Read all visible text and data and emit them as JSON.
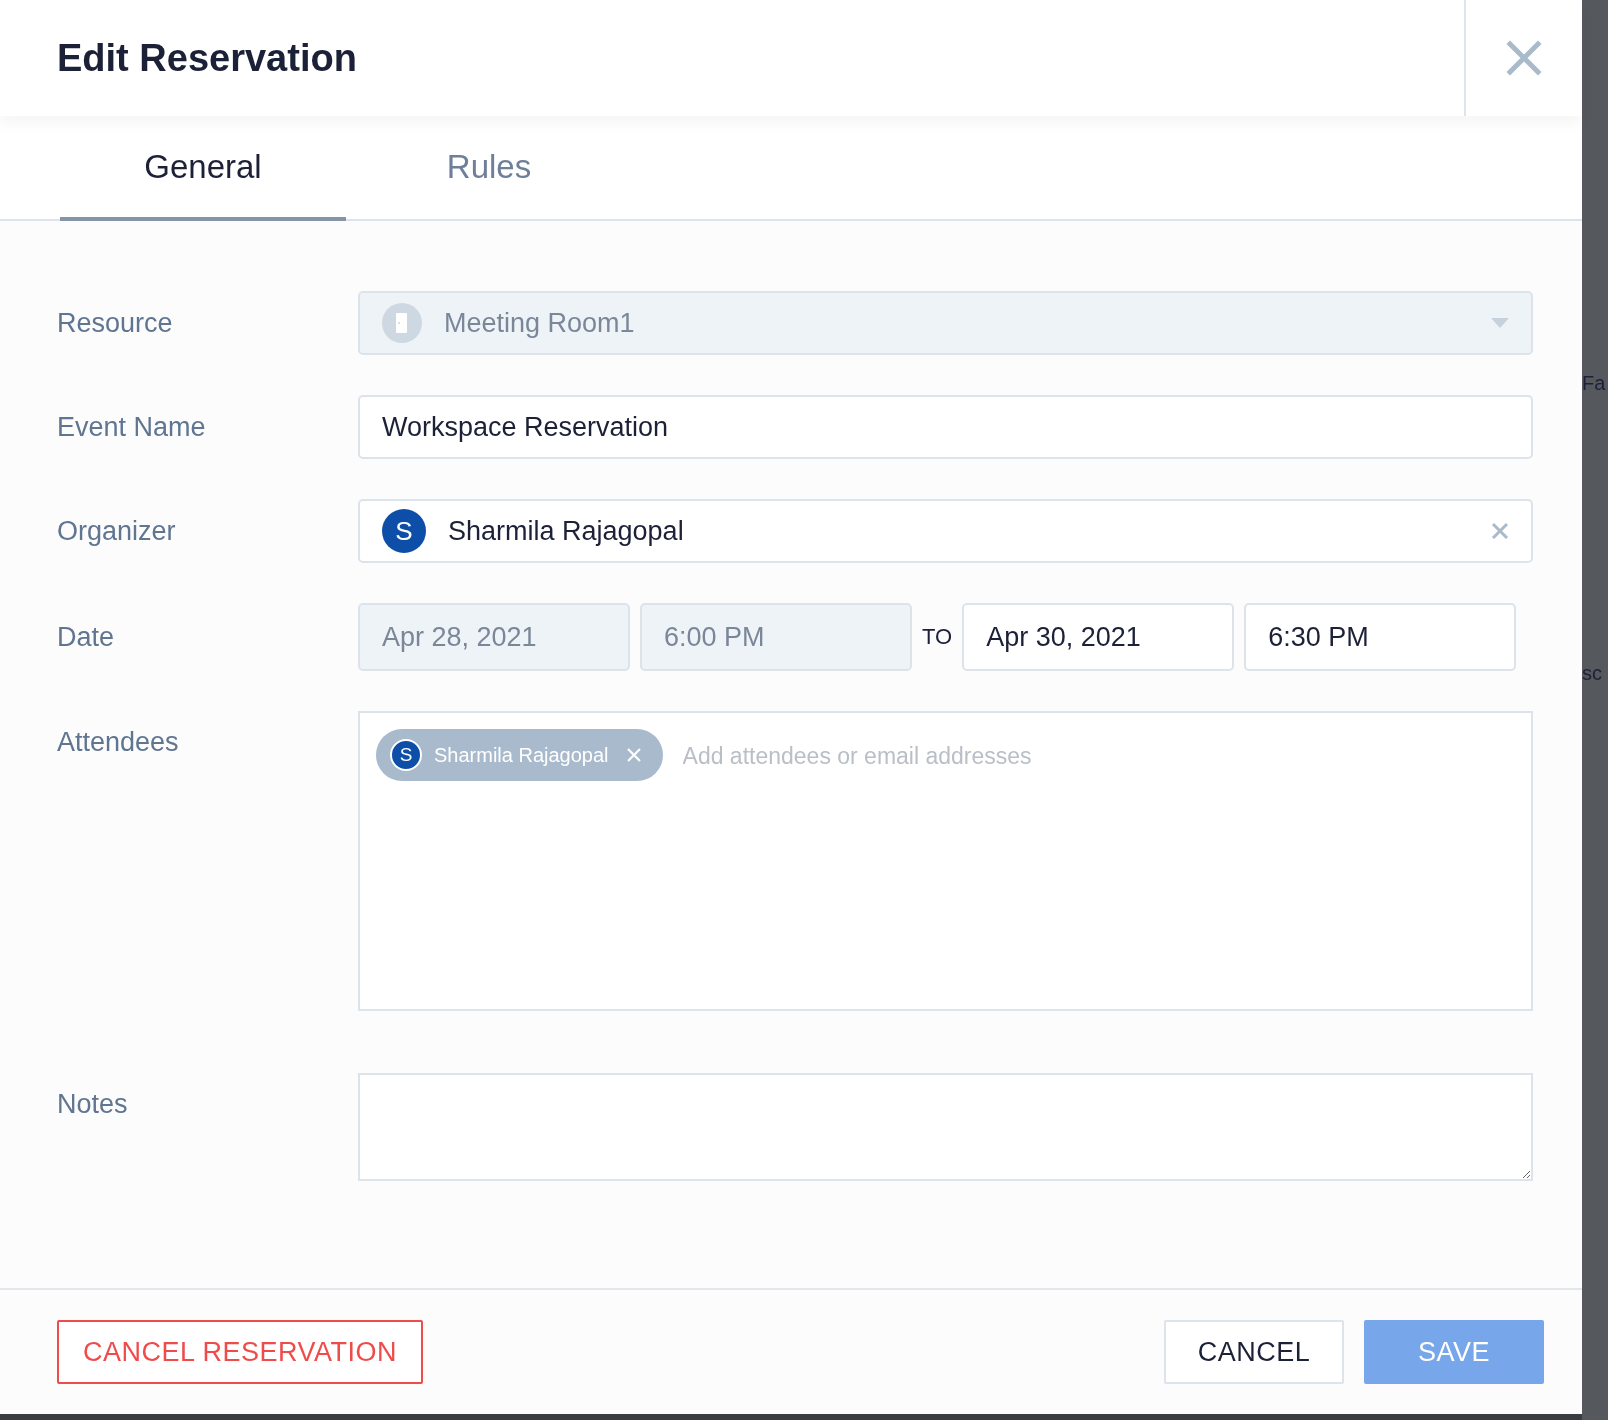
{
  "dialog": {
    "title": "Edit Reservation"
  },
  "tabs": [
    {
      "label": "General",
      "selected": true
    },
    {
      "label": "Rules",
      "selected": false
    }
  ],
  "form": {
    "resource": {
      "label": "Resource",
      "value": "Meeting Room1",
      "disabled": true
    },
    "event_name": {
      "label": "Event Name",
      "value": "Workspace Reservation"
    },
    "organizer": {
      "label": "Organizer",
      "initial": "S",
      "name": "Sharmila Rajagopal"
    },
    "date": {
      "label": "Date",
      "separator": "TO",
      "fields": [
        {
          "value": "Apr 28, 2021",
          "disabled": true
        },
        {
          "value": "6:00 PM",
          "disabled": true
        },
        {
          "value": "Apr 30, 2021",
          "disabled": false
        },
        {
          "value": "6:30 PM",
          "disabled": false
        }
      ]
    },
    "attendees": {
      "label": "Attendees",
      "chips": [
        {
          "initial": "S",
          "name": "Sharmila Rajagopal"
        }
      ],
      "placeholder": "Add attendees or email addresses"
    },
    "notes": {
      "label": "Notes"
    }
  },
  "footer": {
    "cancel_reservation": "CANCEL RESERVATION",
    "cancel": "CANCEL",
    "save": "SAVE"
  },
  "background_window": {
    "fragments": [
      "Fa",
      "sc"
    ]
  }
}
